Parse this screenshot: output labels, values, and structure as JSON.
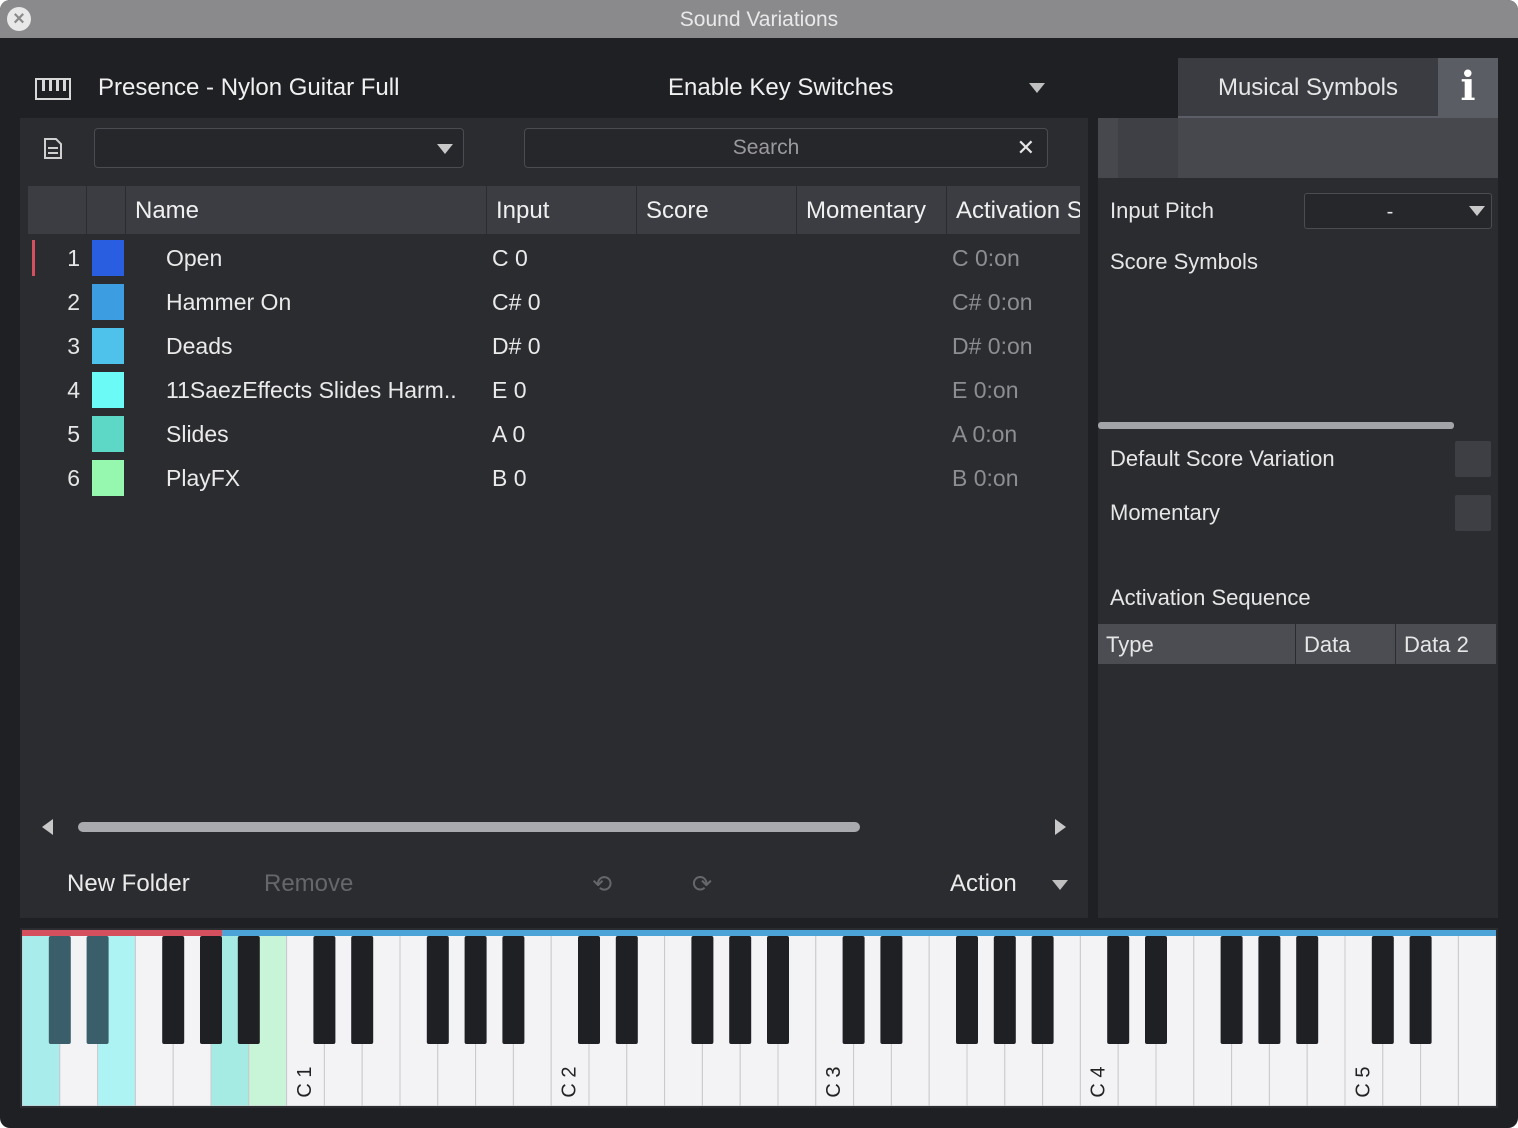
{
  "window": {
    "title": "Sound Variations"
  },
  "header": {
    "preset_name": "Presence - Nylon Guitar Full",
    "key_switch_mode": "Enable Key Switches"
  },
  "tabs": {
    "musical_symbols": "Musical Symbols",
    "info": "i"
  },
  "toolbar": {
    "folder_value": "",
    "search_placeholder": "Search",
    "search_clear": "✕"
  },
  "table": {
    "columns": [
      "",
      "",
      "Name",
      "Input",
      "Score",
      "Momentary",
      "Activation S"
    ],
    "rows": [
      {
        "num": "1",
        "color": "#2a5ee0",
        "name": "Open",
        "input": "C 0",
        "activation": "C 0:on",
        "selected": true
      },
      {
        "num": "2",
        "color": "#3c9ee0",
        "name": "Hammer On",
        "input": "C# 0",
        "activation": "C# 0:on",
        "selected": false
      },
      {
        "num": "3",
        "color": "#4ec2ea",
        "name": "Deads",
        "input": "D# 0",
        "activation": "D# 0:on",
        "selected": false
      },
      {
        "num": "4",
        "color": "#6cfaf6",
        "name": "11SaezEffects Slides Harm..",
        "input": "E 0",
        "activation": "E 0:on",
        "selected": false
      },
      {
        "num": "5",
        "color": "#5ed8c6",
        "name": "Slides",
        "input": "A 0",
        "activation": "A 0:on",
        "selected": false
      },
      {
        "num": "6",
        "color": "#96f7ae",
        "name": "PlayFX",
        "input": "B 0",
        "activation": "B 0:on",
        "selected": false
      }
    ]
  },
  "footer": {
    "new_folder": "New Folder",
    "remove": "Remove",
    "undo": "⟲",
    "redo": "⟳",
    "action": "Action"
  },
  "inspector": {
    "input_pitch_label": "Input Pitch",
    "input_pitch_value": "-",
    "score_symbols": "Score Symbols",
    "default_score_variation": "Default Score Variation",
    "momentary": "Momentary",
    "activation_sequence": "Activation Sequence",
    "seq_columns": [
      "Type",
      "Data",
      "Data 2"
    ]
  },
  "piano": {
    "octave_labels": [
      "C 1",
      "C 2",
      "C 3",
      "C 4",
      "C 5"
    ],
    "active_keys": [
      "C 0",
      "C# 0",
      "D# 0",
      "E 0",
      "A 0",
      "B 0"
    ],
    "colors": {
      "key_switch_range": "#d4505e",
      "playable_range": "#4ca3d8"
    }
  }
}
